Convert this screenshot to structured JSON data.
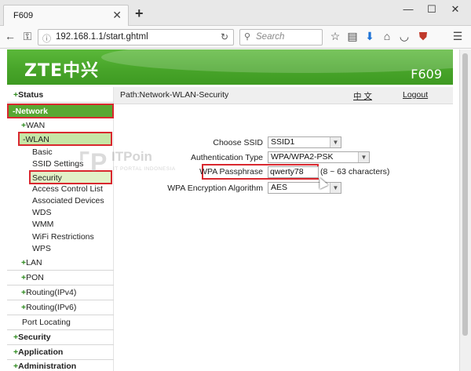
{
  "browser": {
    "tab_title": "F609",
    "tab_close": "✕",
    "new_tab": "+",
    "url": "192.168.1.1/start.ghtml",
    "search_placeholder": "Search",
    "window_controls": {
      "minimize": "—",
      "maximize": "☐",
      "close": "✕"
    }
  },
  "header": {
    "logo": "ZTE中兴",
    "model": "F609",
    "color_top": "#5bb83a",
    "color_bottom": "#3e9a22"
  },
  "sidebar": {
    "items": [
      {
        "label": "Status",
        "prefix": "+"
      },
      {
        "label": "-Network"
      },
      {
        "label": "WAN",
        "prefix": "+"
      },
      {
        "label": "-WLAN"
      },
      {
        "label": "Basic"
      },
      {
        "label": "SSID Settings"
      },
      {
        "label": "Security"
      },
      {
        "label": "Access Control List"
      },
      {
        "label": "Associated Devices"
      },
      {
        "label": "WDS"
      },
      {
        "label": "WMM"
      },
      {
        "label": "WiFi Restrictions"
      },
      {
        "label": "WPS"
      },
      {
        "label": "LAN",
        "prefix": "+"
      },
      {
        "label": "PON",
        "prefix": "+"
      },
      {
        "label": "Routing(IPv4)",
        "prefix": "+"
      },
      {
        "label": "Routing(IPv6)",
        "prefix": "+"
      },
      {
        "label": "Port Locating"
      },
      {
        "label": "Security",
        "prefix": "+"
      },
      {
        "label": "Application",
        "prefix": "+"
      },
      {
        "label": "Administration",
        "prefix": "+"
      }
    ]
  },
  "main": {
    "path": "Path:Network-WLAN-Security",
    "language_link": "中 文",
    "logout_link": "Logout",
    "form": {
      "ssid_label": "Choose SSID",
      "ssid_value": "SSID1",
      "auth_label": "Authentication Type",
      "auth_value": "WPA/WPA2-PSK",
      "passphrase_label": "WPA Passphrase",
      "passphrase_value": "qwerty78",
      "passphrase_hint": "(8 ~ 63 characters)",
      "encryption_label": "WPA Encryption Algorithm",
      "encryption_value": "AES"
    }
  },
  "watermark": {
    "title": "ITPoin",
    "subtitle": "IT PORTAL INDONESIA"
  },
  "highlight_color": "#d9282f"
}
